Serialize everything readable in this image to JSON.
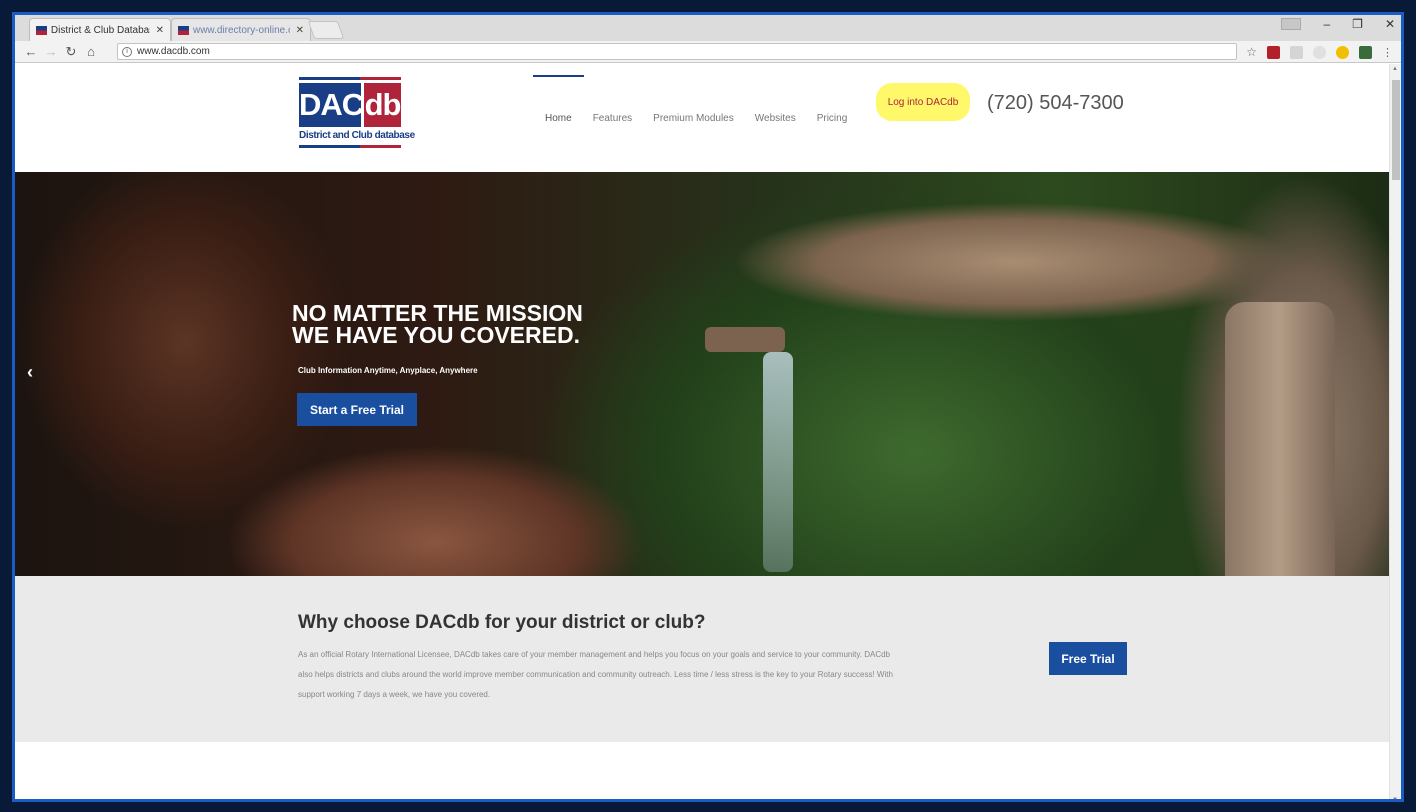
{
  "browser": {
    "tabs": [
      {
        "label": "District & Club Database"
      },
      {
        "label": "www.directory-online.co"
      }
    ],
    "url": "www.dacdb.com"
  },
  "site": {
    "logo": {
      "part1": "DAC",
      "part2": "db",
      "tagline": "District and Club database"
    },
    "nav": [
      "Home",
      "Features",
      "Premium Modules",
      "Websites",
      "Pricing"
    ],
    "login_label": "Log into DACdb",
    "phone": "(720) 504-7300"
  },
  "hero": {
    "title_line1": "NO MATTER THE MISSION",
    "title_line2": "WE HAVE YOU COVERED.",
    "subtitle": "Club Information Anytime, Anyplace, Anywhere",
    "cta": "Start a Free Trial"
  },
  "why": {
    "title": "Why choose DACdb for your district or club?",
    "body": "As an official Rotary International Licensee, DACdb takes care of your member management and helps you focus on your goals and service to your community. DACdb also helps districts and clubs around the world improve member communication and community outreach. Less time / less stress is the key to your Rotary success! With support working 7 days a week, we have you covered.",
    "cta": "Free Trial"
  },
  "colors": {
    "brand_blue": "#1a3e85",
    "brand_red": "#b0243b",
    "button_blue": "#1a4fa0",
    "login_highlight": "#fff86a"
  }
}
